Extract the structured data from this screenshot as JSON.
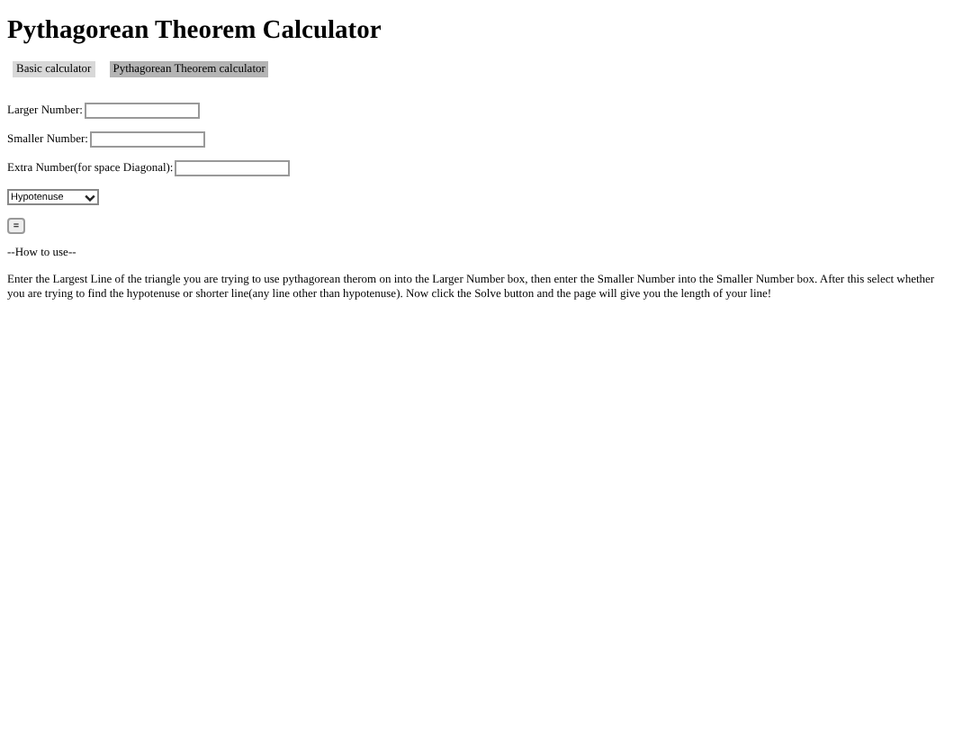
{
  "title": "Pythagorean Theorem Calculator",
  "nav": [
    {
      "label": "Basic calculator",
      "selected": false
    },
    {
      "label": "Pythagorean Theorem calculator",
      "selected": true
    }
  ],
  "fields": [
    {
      "label": "Larger Number:"
    },
    {
      "label": "Smaller Number:"
    },
    {
      "label": "Extra Number(for space Diagonal):"
    }
  ],
  "select": {
    "value": "Hypotenuse"
  },
  "solve_button": "=",
  "how_to_heading": "--How to use--",
  "instructions": "Enter the Largest Line of the triangle you are trying to use pythagorean therom on into the Larger Number box, then enter the Smaller Number into the Smaller Number box. After this select whether you are trying to find the hypotenuse or shorter line(any line other than hypotenuse). Now click the Solve button and the page will give you the length of your line!"
}
